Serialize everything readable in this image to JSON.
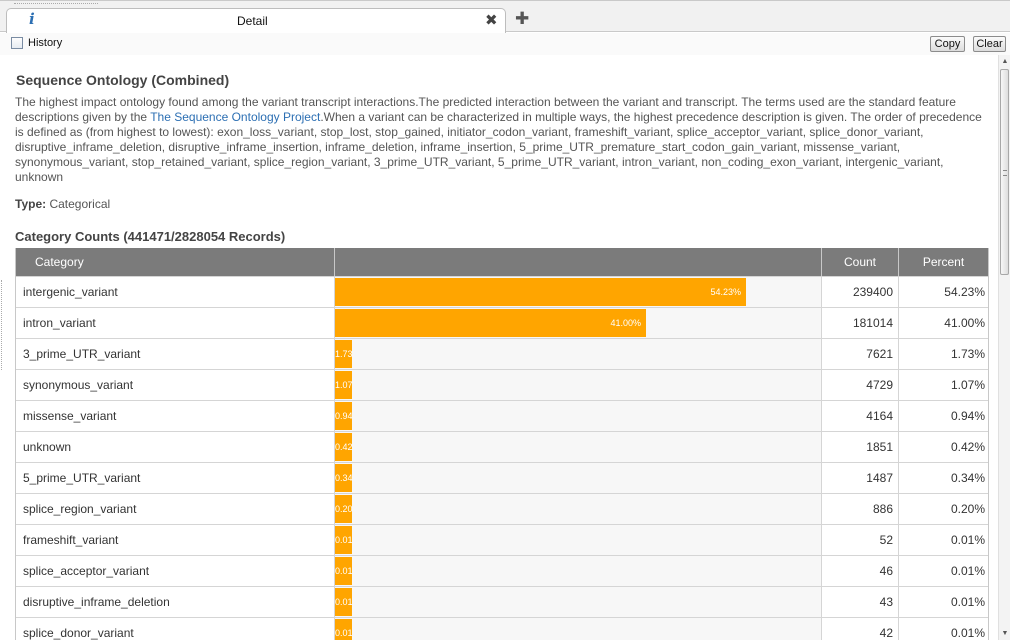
{
  "tab": {
    "title": "Detail",
    "info_icon": "i"
  },
  "toolbar": {
    "history_label": "History",
    "copy_label": "Copy",
    "clear_label": "Clear"
  },
  "field": {
    "title": "Sequence Ontology (Combined)",
    "desc_before": "The highest impact ontology found among the variant transcript interactions.The predicted interaction between the variant and transcript. The terms used are the standard feature descriptions given by the ",
    "desc_link": "The Sequence Ontology Project",
    "desc_after": ".When a variant can be characterized in multiple ways, the highest precedence description is given. The order of precedence is defined as (from highest to lowest): exon_loss_variant, stop_lost, stop_gained, initiator_codon_variant, frameshift_variant, splice_acceptor_variant, splice_donor_variant, disruptive_inframe_deletion, disruptive_inframe_insertion, inframe_deletion, inframe_insertion, 5_prime_UTR_premature_start_codon_gain_variant, missense_variant, synonymous_variant, stop_retained_variant, splice_region_variant, 3_prime_UTR_variant, 5_prime_UTR_variant, intron_variant, non_coding_exon_variant, intergenic_variant, unknown",
    "type_label": "Type:",
    "type_value": " Categorical",
    "counts_title": "Category Counts (441471/2828054 Records)"
  },
  "table": {
    "headers": {
      "category": "Category",
      "bar": "",
      "count": "Count",
      "percent": "Percent"
    },
    "rows": [
      {
        "category": "intergenic_variant",
        "count": "239400",
        "percent": "54.23%",
        "fraction": 0.5423
      },
      {
        "category": "intron_variant",
        "count": "181014",
        "percent": "41.00%",
        "fraction": 0.41
      },
      {
        "category": "3_prime_UTR_variant",
        "count": "7621",
        "percent": "1.73%",
        "fraction": 0.0173
      },
      {
        "category": "synonymous_variant",
        "count": "4729",
        "percent": "1.07%",
        "fraction": 0.0107
      },
      {
        "category": "missense_variant",
        "count": "4164",
        "percent": "0.94%",
        "fraction": 0.0094
      },
      {
        "category": "unknown",
        "count": "1851",
        "percent": "0.42%",
        "fraction": 0.0042
      },
      {
        "category": "5_prime_UTR_variant",
        "count": "1487",
        "percent": "0.34%",
        "fraction": 0.0034
      },
      {
        "category": "splice_region_variant",
        "count": "886",
        "percent": "0.20%",
        "fraction": 0.002
      },
      {
        "category": "frameshift_variant",
        "count": "52",
        "percent": "0.01%",
        "fraction": 0.0001
      },
      {
        "category": "splice_acceptor_variant",
        "count": "46",
        "percent": "0.01%",
        "fraction": 0.0001
      },
      {
        "category": "disruptive_inframe_deletion",
        "count": "43",
        "percent": "0.01%",
        "fraction": 0.0001
      },
      {
        "category": "splice_donor_variant",
        "count": "42",
        "percent": "0.01%",
        "fraction": 0.0001
      }
    ]
  },
  "colors": {
    "bar": "#ffa500",
    "header_bg": "#7b7b7b",
    "link": "#2c6fb3"
  },
  "icons": {
    "info": "info-icon",
    "close": "close-icon",
    "add": "add-tab-icon",
    "checkbox": "checkbox-icon"
  }
}
